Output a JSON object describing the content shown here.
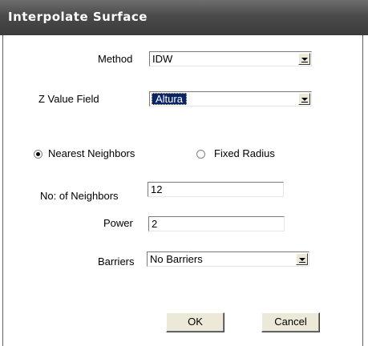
{
  "window": {
    "title": "Interpolate Surface"
  },
  "method": {
    "label": "Method",
    "value": "IDW"
  },
  "z_value_field": {
    "label": "Z Value Field",
    "value": "Altura"
  },
  "search": {
    "nearest_label": "Nearest Neighbors",
    "nearest_selected": true,
    "fixed_label": "Fixed Radius",
    "fixed_selected": false
  },
  "neighbors": {
    "label": "No: of Neighbors",
    "value": "12"
  },
  "power": {
    "label": "Power",
    "value": "2"
  },
  "barriers": {
    "label": "Barriers",
    "value": "No Barriers"
  },
  "buttons": {
    "ok": "OK",
    "cancel": "Cancel"
  }
}
